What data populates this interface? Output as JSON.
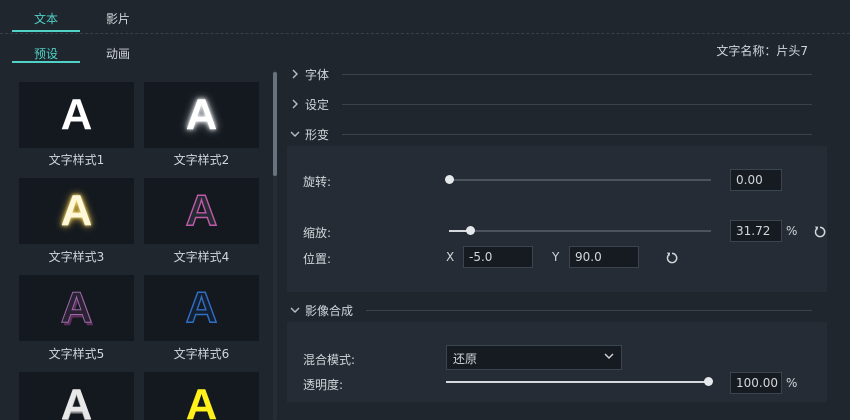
{
  "tabs": {
    "text": "文本",
    "film": "影片"
  },
  "subtabs": {
    "presets": "预设",
    "animation": "动画"
  },
  "styles": [
    {
      "letter": "A",
      "label": "文字样式1"
    },
    {
      "letter": "A",
      "label": "文字样式2"
    },
    {
      "letter": "A",
      "label": "文字样式3"
    },
    {
      "letter": "A",
      "label": "文字样式4"
    },
    {
      "letter": "A",
      "label": "文字样式5"
    },
    {
      "letter": "A",
      "label": "文字样式6"
    },
    {
      "letter": "A",
      "label": ""
    },
    {
      "letter": "A",
      "label": ""
    }
  ],
  "text_name": "文字名称：片头7",
  "sections": {
    "font": "字体",
    "settings": "设定",
    "transform": "形变",
    "compositing": "影像合成"
  },
  "transform": {
    "rotation_label": "旋转:",
    "rotation_value": "0.00",
    "rotation_fraction": 0.0,
    "scale_label": "缩放:",
    "scale_value": "31.72",
    "scale_unit": "%",
    "scale_fraction": 0.08,
    "position_label": "位置:",
    "x_label": "X",
    "x_value": "-5.0",
    "y_label": "Y",
    "y_value": "90.0"
  },
  "compositing": {
    "blend_label": "混合模式:",
    "blend_value": "还原",
    "opacity_label": "透明度:",
    "opacity_value": "100.00",
    "opacity_unit": "%",
    "opacity_fraction": 1.0
  },
  "colors": {
    "accent": "#4fd1c5",
    "background": "#1f262e",
    "panel": "#252c35"
  },
  "icons": [
    "chevron-right-icon",
    "chevron-down-icon",
    "reset-icon"
  ]
}
